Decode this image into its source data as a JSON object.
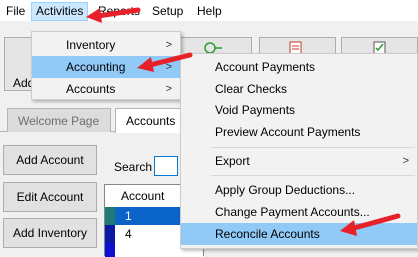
{
  "menubar": {
    "items": [
      {
        "label": "File"
      },
      {
        "label": "Activities"
      },
      {
        "label": "Reports"
      },
      {
        "label": "Setup"
      },
      {
        "label": "Help"
      }
    ]
  },
  "toolbar": {
    "partial_add_label": "Add"
  },
  "tabs": [
    {
      "label": "Welcome Page"
    },
    {
      "label": "Accounts"
    }
  ],
  "left_buttons": [
    {
      "label": "Add Account"
    },
    {
      "label": "Edit Account"
    },
    {
      "label": "Add Inventory"
    }
  ],
  "search": {
    "label": "Search"
  },
  "grid": {
    "header": "Account",
    "rows": [
      {
        "value": "1"
      },
      {
        "value": "4"
      }
    ],
    "row_colors": [
      "#1f7a73",
      "#0a1aa6"
    ]
  },
  "activities_menu": {
    "items": [
      {
        "label": "Inventory"
      },
      {
        "label": "Accounting"
      },
      {
        "label": "Accounts"
      }
    ]
  },
  "accounting_menu": {
    "items": [
      {
        "label": "Account Payments"
      },
      {
        "label": "Clear Checks"
      },
      {
        "label": "Void Payments"
      },
      {
        "label": "Preview Account Payments"
      },
      {
        "label": "Export"
      },
      {
        "label": "Apply Group Deductions..."
      },
      {
        "label": "Change Payment Accounts..."
      },
      {
        "label": "Reconcile Accounts"
      }
    ]
  },
  "colors": {
    "highlight": "#91c9f7",
    "menu_active": "#cce8ff",
    "annotation": "#e8202a"
  },
  "icons": {
    "submenu_arrow": "›",
    "sort_arrow": "⌄"
  }
}
